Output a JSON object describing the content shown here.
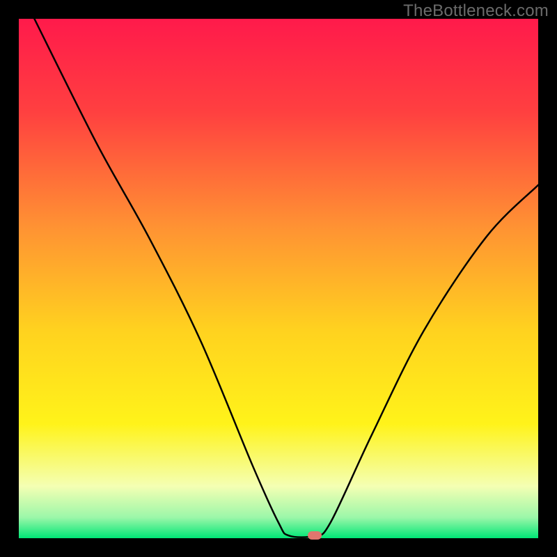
{
  "watermark": "TheBottleneck.com",
  "chart_data": {
    "type": "line",
    "title": "",
    "xlabel": "",
    "ylabel": "",
    "xlim": [
      0,
      100
    ],
    "ylim": [
      0,
      100
    ],
    "grid": false,
    "legend": "none",
    "background": {
      "type": "vertical-gradient",
      "stops": [
        {
          "pct": 0,
          "color": "#ff1a4b"
        },
        {
          "pct": 18,
          "color": "#ff4040"
        },
        {
          "pct": 40,
          "color": "#ff9233"
        },
        {
          "pct": 60,
          "color": "#ffd21f"
        },
        {
          "pct": 78,
          "color": "#fff31a"
        },
        {
          "pct": 90,
          "color": "#f4ffb3"
        },
        {
          "pct": 96,
          "color": "#9cf7a9"
        },
        {
          "pct": 100,
          "color": "#00e676"
        }
      ]
    },
    "series": [
      {
        "name": "bottleneck-curve",
        "color": "#000000",
        "points": [
          {
            "x": 3,
            "y": 100
          },
          {
            "x": 15,
            "y": 76
          },
          {
            "x": 25,
            "y": 58
          },
          {
            "x": 35,
            "y": 38
          },
          {
            "x": 45,
            "y": 14
          },
          {
            "x": 50,
            "y": 3
          },
          {
            "x": 52,
            "y": 0.5
          },
          {
            "x": 57,
            "y": 0.5
          },
          {
            "x": 60,
            "y": 3
          },
          {
            "x": 68,
            "y": 20
          },
          {
            "x": 78,
            "y": 40
          },
          {
            "x": 90,
            "y": 58
          },
          {
            "x": 100,
            "y": 68
          }
        ]
      }
    ],
    "marker": {
      "x": 57,
      "y": 0.5,
      "color": "#e0766e"
    }
  }
}
